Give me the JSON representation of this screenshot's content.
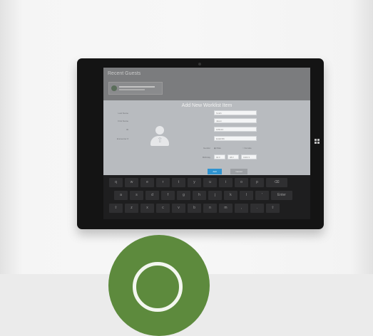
{
  "app": {
    "title": "Recent Guests",
    "card_line_1": "",
    "card_line_2": ""
  },
  "dialog": {
    "title": "Add New Worklist Item",
    "fields": [
      {
        "label": "Last Name",
        "value": "Smith"
      },
      {
        "label": "First Name",
        "value": "Jason"
      },
      {
        "label": "ID",
        "value": "105134"
      },
      {
        "label": "Encounter #",
        "value": "EAEFRK"
      }
    ],
    "gender_label": "Gender",
    "gender_options": [
      "Male",
      "Female"
    ],
    "birthday_label": "Birthday",
    "birthday_values": [
      "02",
      "08",
      "1963"
    ],
    "primary_button": "Add",
    "secondary_button": "Cancel"
  },
  "keyboard": {
    "row1": [
      "q",
      "w",
      "e",
      "r",
      "t",
      "y",
      "u",
      "i",
      "o",
      "p",
      "⌫"
    ],
    "row2": [
      "a",
      "s",
      "d",
      "f",
      "g",
      "h",
      "j",
      "k",
      "l",
      "'",
      "Enter"
    ],
    "row3": [
      "⇧",
      "z",
      "x",
      "c",
      "v",
      "b",
      "n",
      "m",
      ",",
      ".",
      "⇧"
    ]
  },
  "colors": {
    "badge": "#5d8a3d",
    "primary_button": "#2f93d0",
    "dialog_background": "#b8bbbf"
  },
  "icons": {
    "upload_avatar": "person-upload-icon",
    "windows": "windows-logo-icon"
  }
}
